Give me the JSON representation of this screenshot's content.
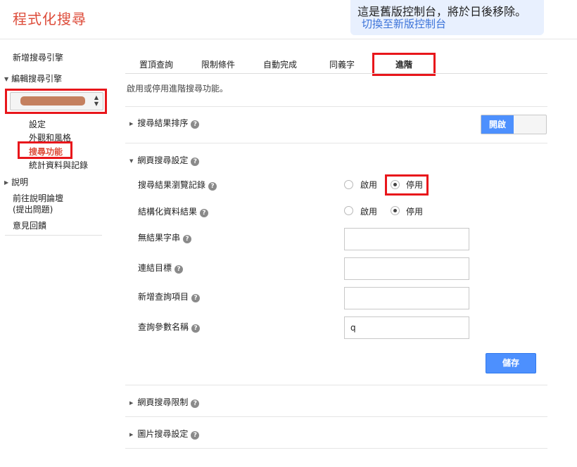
{
  "app": {
    "title": "程式化搜尋"
  },
  "notice": {
    "text": "這是舊版控制台，將於日後移除。",
    "link": "切換至新版控制台"
  },
  "sidebar": {
    "new_engine": "新增搜尋引擎",
    "edit_engine": "編輯搜尋引擎",
    "sub_items": [
      "設定",
      "外觀和風格",
      "搜尋功能",
      "統計資料與記錄"
    ],
    "help": "說明",
    "forum_line1": "前往說明論壇",
    "forum_line2": "(提出問題)",
    "feedback": "意見回饋"
  },
  "tabs": [
    "置頂查詢",
    "限制條件",
    "自動完成",
    "同義字",
    "進階"
  ],
  "active_tab": "進階",
  "description": "啟用或停用進階搜尋功能。",
  "sections": {
    "ranking": {
      "title": "搜尋結果排序",
      "toggle_label": "開啟"
    },
    "web_search": {
      "title": "網頁搜尋設定",
      "rows": {
        "browsing_history": {
          "label": "搜尋結果瀏覽記錄",
          "enable": "啟用",
          "disable": "停用",
          "selected": "停用"
        },
        "structured_data": {
          "label": "結構化資料結果",
          "enable": "啟用",
          "disable": "停用",
          "selected": "停用"
        },
        "no_results": {
          "label": "無結果字串",
          "value": ""
        },
        "link_target": {
          "label": "連結目標",
          "value": ""
        },
        "add_query": {
          "label": "新增查詢項目",
          "value": ""
        },
        "query_param": {
          "label": "查詢參數名稱",
          "value": "q"
        }
      },
      "save_label": "儲存"
    },
    "web_restrictions": {
      "title": "網頁搜尋限制"
    },
    "image_search": {
      "title": "圖片搜尋設定"
    }
  },
  "colors": {
    "accent": "#4d90fe",
    "title": "#dd4b39",
    "highlight_box": "#e8161b",
    "notice_bg": "#e8f0fe"
  }
}
